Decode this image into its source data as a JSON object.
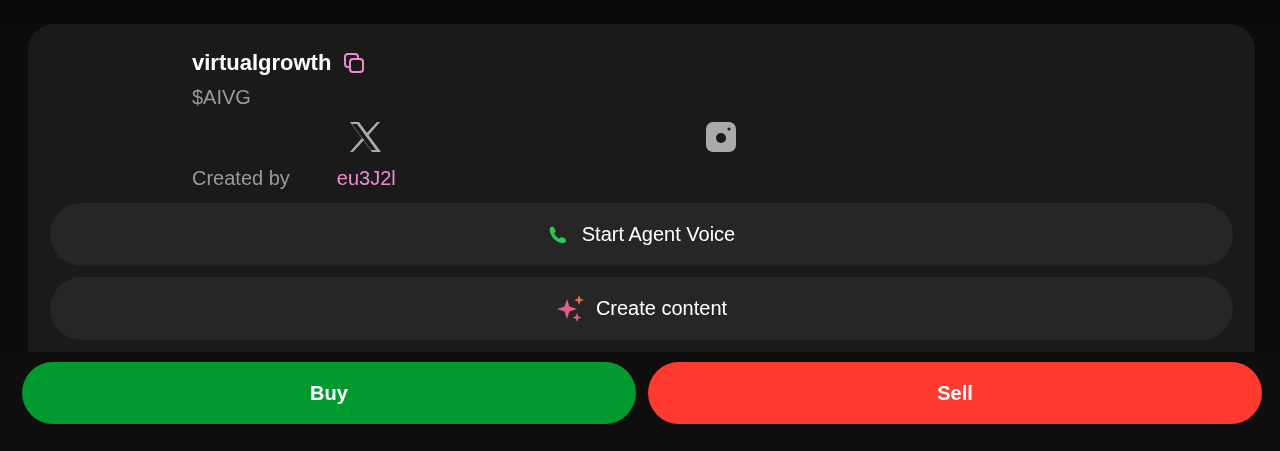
{
  "token": {
    "name": "virtualgrowth",
    "ticker": "$AIVG"
  },
  "socials": [
    {
      "kind": "x"
    },
    {
      "kind": "instagram"
    }
  ],
  "creator": {
    "label": "Created by",
    "handle": "eu3J2l"
  },
  "actions": [
    {
      "kind": "voice",
      "label": "Start Agent Voice"
    },
    {
      "kind": "create",
      "label": "Create content"
    }
  ],
  "trade": [
    {
      "kind": "buy",
      "label": "Buy"
    },
    {
      "kind": "sell",
      "label": "Sell"
    }
  ]
}
